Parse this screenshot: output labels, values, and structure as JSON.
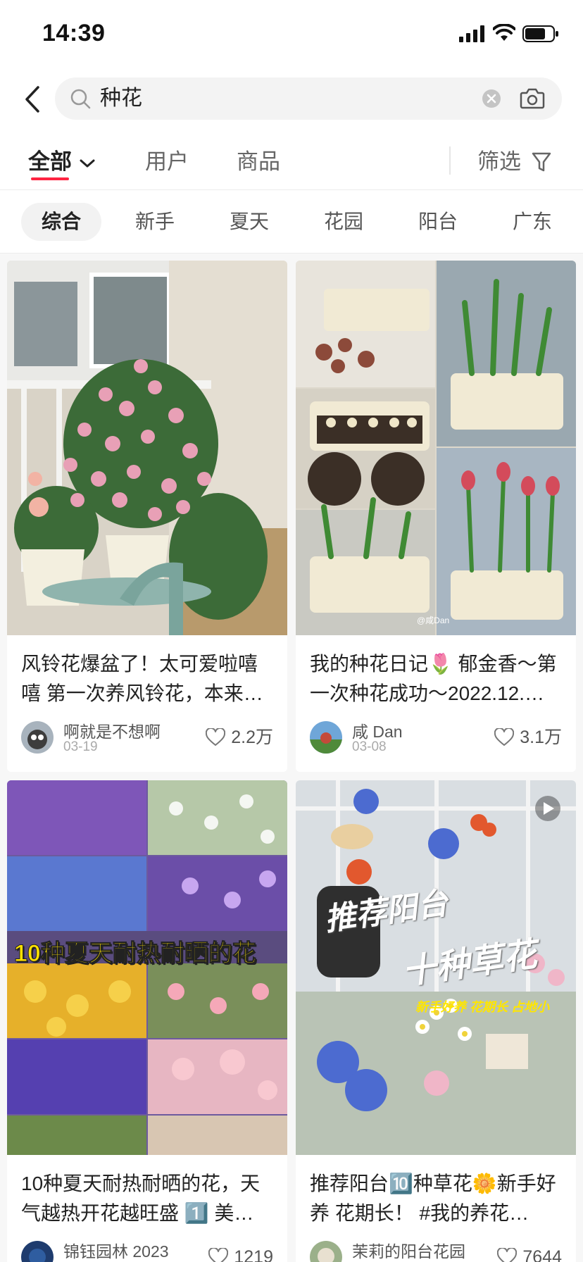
{
  "status_bar": {
    "time": "14:39"
  },
  "search": {
    "query": "种花"
  },
  "tabs": {
    "all": "全部",
    "users": "用户",
    "goods": "商品",
    "filter": "筛选"
  },
  "chips": [
    "综合",
    "新手",
    "夏天",
    "花园",
    "阳台",
    "广东"
  ],
  "colors": {
    "accent": "#ff2442"
  },
  "feed": [
    {
      "title": "风铃花爆盆了！太可爱啦嘻嘻 第一次养风铃花，本来…",
      "author": "啊就是不想啊",
      "date": "03-19",
      "likes": "2.2万"
    },
    {
      "title": "我的种花日记🌷 郁金香～第一次种花成功～2022.12.…",
      "author": "咸 Dan",
      "date": "03-08",
      "likes": "3.1万",
      "watermark": "@咸Dan"
    },
    {
      "title": "10种夏天耐热耐晒的花，天气越热开花越旺盛 1️⃣ 美…",
      "author": "锦钰园林 2023",
      "likes": "1219",
      "overlay": "10种夏天耐热耐晒的花"
    },
    {
      "title": "推荐阳台🔟种草花🌼新手好养 花期长！ #我的养花…",
      "author": "茉莉的阳台花园",
      "likes": "7644",
      "overlay_line1": "推荐阳台",
      "overlay_line2": "十种草花",
      "overlay_sub": "新手好养 花期长 占地小"
    }
  ]
}
